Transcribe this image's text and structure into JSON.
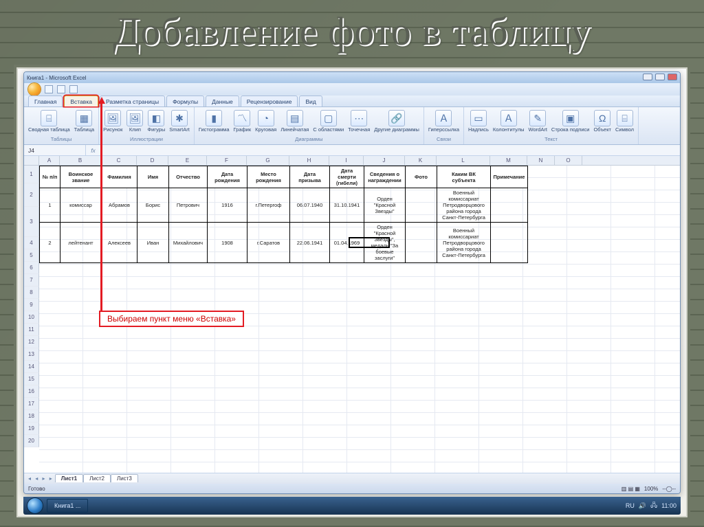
{
  "slide": {
    "title": "Добавление фото в таблицу"
  },
  "window": {
    "title": "Книга1 - Microsoft Excel",
    "tabs": [
      "Главная",
      "Вставка",
      "Разметка страницы",
      "Формулы",
      "Данные",
      "Рецензирование",
      "Вид"
    ],
    "active_tab_index": 1,
    "ribbon_groups": [
      {
        "label": "Таблицы",
        "items": [
          "Сводная таблица",
          "Таблица"
        ]
      },
      {
        "label": "Иллюстрации",
        "items": [
          "Рисунок",
          "Клип",
          "Фигуры",
          "SmartArt"
        ]
      },
      {
        "label": "Диаграммы",
        "items": [
          "Гистограмма",
          "График",
          "Круговая",
          "Линейчатая",
          "С областями",
          "Точечная",
          "Другие диаграммы"
        ]
      },
      {
        "label": "Связи",
        "items": [
          "Гиперссылка"
        ]
      },
      {
        "label": "Текст",
        "items": [
          "Надпись",
          "Колонтитулы",
          "WordArt",
          "Строка подписи",
          "Объект",
          "Символ"
        ]
      }
    ],
    "cellref": "J4",
    "columns": [
      "A",
      "B",
      "C",
      "D",
      "E",
      "F",
      "G",
      "H",
      "I",
      "J",
      "K",
      "L",
      "M",
      "N",
      "O"
    ],
    "statusbar": {
      "left": "Готово",
      "zoom": "100%"
    },
    "sheet_tabs": [
      "Лист1",
      "Лист2",
      "Лист3"
    ],
    "active_sheet": 0
  },
  "callout": {
    "text": "Выбираем пункт меню «Вставка»"
  },
  "spreadsheet": {
    "headers": [
      "№ п/п",
      "Воинское звание",
      "Фамилия",
      "Имя",
      "Отчество",
      "Дата рождения",
      "Место рождения",
      "Дата призыва",
      "Дата смерти (гибели)",
      "Сведения о награждении",
      "Фото",
      "Каким ВК субъекта",
      "Примечание"
    ],
    "rows": [
      {
        "cells": [
          "1",
          "комиссар",
          "Абрамов",
          "Борис",
          "Петрович",
          "1916",
          "г.Петергоф",
          "06.07.1940",
          "31.10.1941",
          "Орден \"Красной Звезды\"",
          "",
          "Военный комиссариат Петродворцового района города Санкт-Петербурга",
          ""
        ]
      },
      {
        "cells": [
          "2",
          "лейтенант",
          "Алексеев",
          "Иван",
          "Михайлович",
          "1908",
          "г.Саратов",
          "22.06.1941",
          "01.04.1969",
          "Орден \"Красной Звезды\", медаль \"За боевые заслуги\"",
          "",
          "Военный комиссариат Петродворцового района города Санкт-Петербурга",
          ""
        ]
      }
    ]
  },
  "taskbar": {
    "app_button": "Книга1 ...",
    "time": "11:00"
  }
}
